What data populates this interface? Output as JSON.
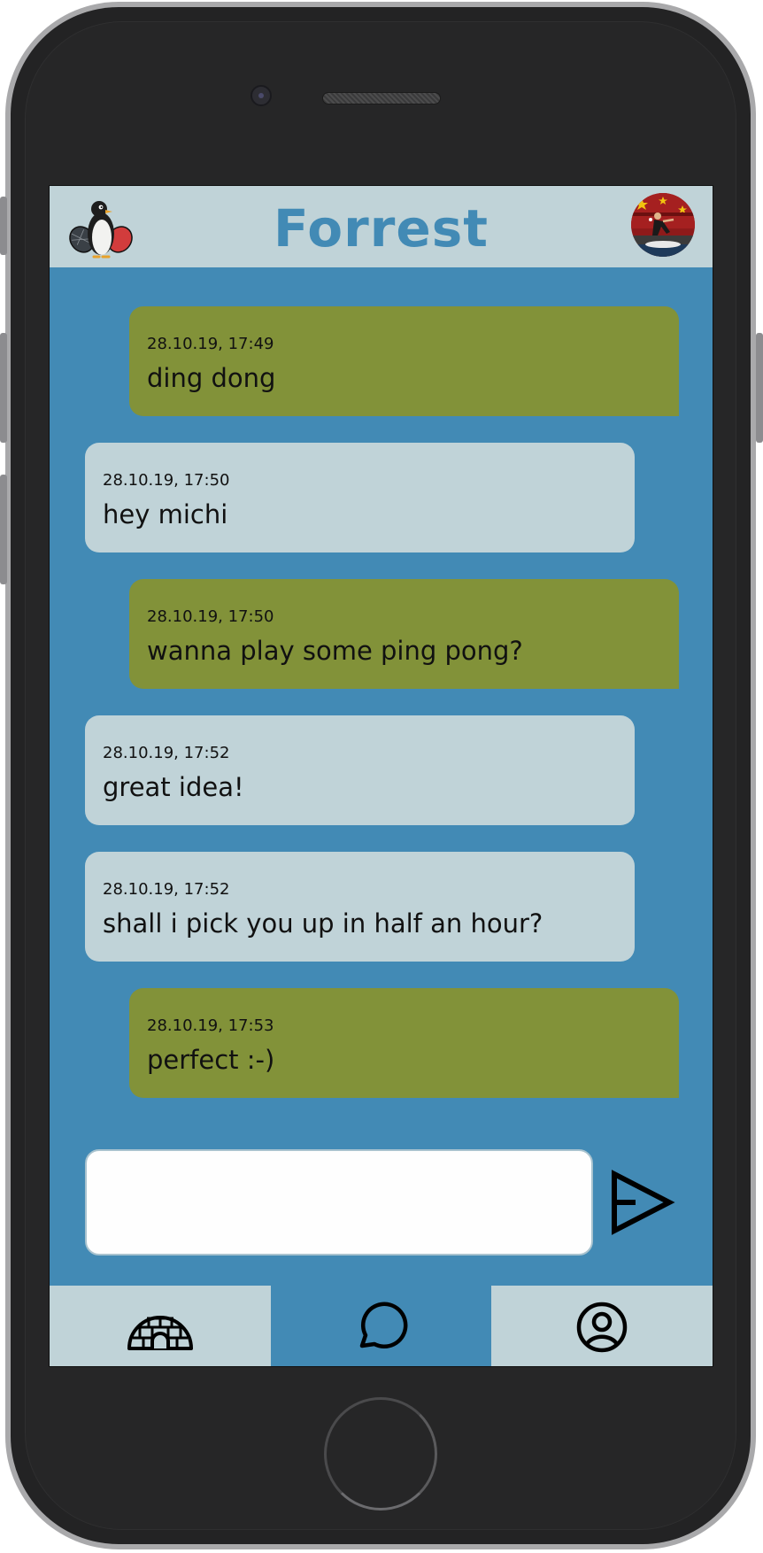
{
  "app": {
    "title": "Forrest",
    "logo_icon": "penguin-with-ping-pong-paddles-icon",
    "avatar_icon": "profile-photo-ping-pong-player"
  },
  "colors": {
    "primary_blue": "#428ab5",
    "light_panel": "#c0d3d8",
    "outgoing_bubble": "#829239",
    "incoming_bubble": "#c0d3d8"
  },
  "messages": [
    {
      "direction": "outgoing",
      "timestamp": "28.10.19, 17:49",
      "text": "ding dong"
    },
    {
      "direction": "incoming",
      "timestamp": "28.10.19, 17:50",
      "text": "hey michi"
    },
    {
      "direction": "outgoing",
      "timestamp": "28.10.19, 17:50",
      "text": "wanna play some ping pong?"
    },
    {
      "direction": "incoming",
      "timestamp": "28.10.19, 17:52",
      "text": "great idea!"
    },
    {
      "direction": "incoming",
      "timestamp": "28.10.19, 17:52",
      "text": "shall i pick you up in half an hour?"
    },
    {
      "direction": "outgoing",
      "timestamp": "28.10.19, 17:53",
      "text": "perfect :-)"
    }
  ],
  "composer": {
    "value": "",
    "placeholder": "",
    "send_icon": "send-arrow-icon"
  },
  "nav": {
    "items": [
      {
        "icon": "igloo-icon",
        "active": false
      },
      {
        "icon": "chat-bubble-icon",
        "active": true
      },
      {
        "icon": "user-profile-icon",
        "active": false
      }
    ]
  }
}
